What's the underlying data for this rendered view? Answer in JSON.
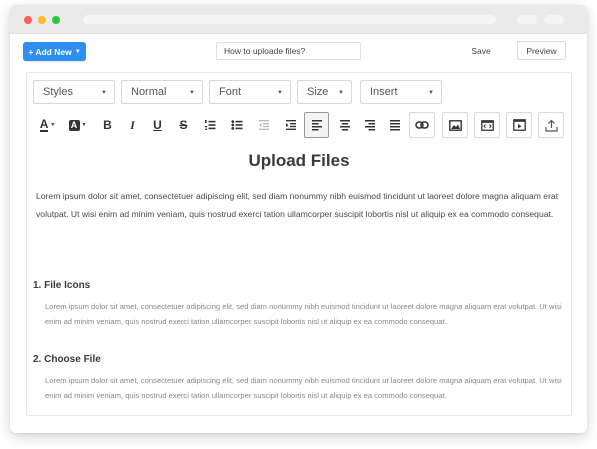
{
  "header": {
    "add_new_label": "+ Add New",
    "title_input_value": "How to uploade files?",
    "save_label": "Save",
    "preview_label": "Preview"
  },
  "toolbar": {
    "dropdowns": [
      {
        "label": "Styles"
      },
      {
        "label": "Normal"
      },
      {
        "label": "Font"
      },
      {
        "label": "Size"
      },
      {
        "label": "Insert"
      }
    ],
    "buttons": [
      {
        "glyph": "A"
      },
      {
        "glyph": "A"
      },
      {
        "glyph": "B"
      },
      {
        "glyph": "I"
      },
      {
        "glyph": "U"
      },
      {
        "glyph": "S"
      }
    ]
  },
  "document": {
    "title": "Upload Files",
    "intro": "Lorem ipsum dolor sit amet, consectetuer adipiscing elit, sed diam nonummy nibh euismod tincidunt ut laoreet dolore magna aliquam erat volutpat. Ut wisi enim ad minim veniam, quis nostrud exerci tation ullamcorper suscipit lobortis nisl ut aliquip ex ea commodo consequat.",
    "sections": [
      {
        "heading": "1. File Icons",
        "body": "Lorem ipsum dolor sit amet, consectetuer adipiscing elit, sed diam nonummy nibh euismod tincidunt ut laoreet dolore magna aliquam erat volutpat. Ut wisi enim ad minim veniam, quis nostrud exerci tation ullamcorper suscipit lobortis nisl ut aliquip ex ea commodo consequat."
      },
      {
        "heading": "2. Choose File",
        "body": "Lorem ipsum dolor sit amet, consectetuer adipiscing elit, sed diam nonummy nibh euismod tincidunt ut laoreet dolore magna aliquam erat volutpat. Ut wisi enim ad minim veniam, quis nostrud exerci tation ullamcorper suscipit lobortis nisl ut aliquip ex ea commodo consequat."
      }
    ]
  },
  "colors": {
    "accent": "#2f8ff0",
    "window_chrome": "#eaeaea",
    "close_dot": "#ff5f57",
    "minimize_dot": "#febc2e",
    "maximize_dot": "#28c840"
  }
}
